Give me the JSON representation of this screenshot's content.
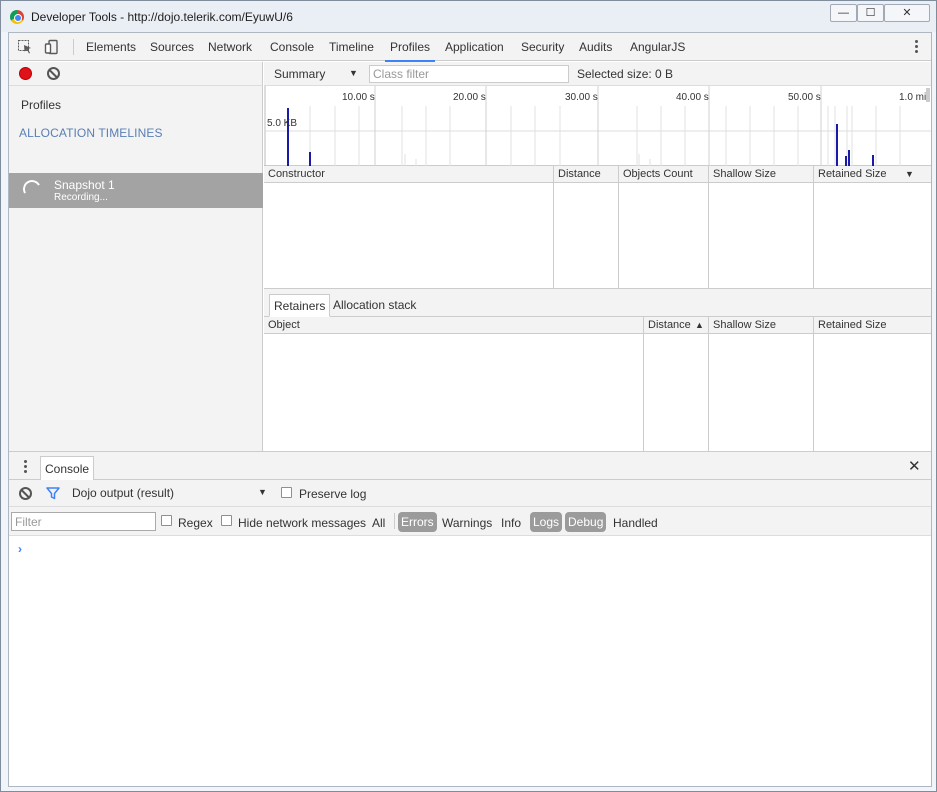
{
  "window": {
    "title": "Developer Tools - http://dojo.telerik.com/EyuwU/6",
    "controls": {
      "minimize": "—",
      "maximize": "☐",
      "close": "✕"
    }
  },
  "devtools": {
    "main_tabs": [
      "Elements",
      "Sources",
      "Network",
      "Console",
      "Timeline",
      "Profiles",
      "Application",
      "Security",
      "Audits",
      "AngularJS"
    ],
    "active_tab": "Profiles"
  },
  "profiles": {
    "section_label": "Profiles",
    "group_heading": "ALLOCATION TIMELINES",
    "snapshot": {
      "title": "Snapshot 1",
      "status": "Recording..."
    }
  },
  "summary_toolbar": {
    "view_select": "Summary",
    "class_filter_placeholder": "Class filter",
    "selected_size": "Selected size: 0 B"
  },
  "timeline": {
    "ticks": [
      "10.00 s",
      "20.00 s",
      "30.00 s",
      "40.00 s",
      "50.00 s",
      "1.0 mi"
    ],
    "y_label": "5.0 KB"
  },
  "constructor_grid": {
    "columns": [
      "Constructor",
      "Distance",
      "Objects Count",
      "Shallow Size",
      "Retained Size"
    ],
    "sort_indicator": "▼"
  },
  "retainers": {
    "tabs": [
      "Retainers",
      "Allocation stack"
    ],
    "columns": [
      "Object",
      "Distance",
      "Shallow Size",
      "Retained Size"
    ],
    "sort_indicator": "▲"
  },
  "console": {
    "tab_label": "Console",
    "close_glyph": "✕",
    "context": "Dojo output (result)",
    "preserve_log": "Preserve log",
    "filter_placeholder": "Filter",
    "regex": "Regex",
    "hide_network": "Hide network messages",
    "levels": [
      "All",
      "Errors",
      "Warnings",
      "Info",
      "Logs",
      "Debug",
      "Handled"
    ],
    "prompt": "›"
  },
  "icons": {
    "inspect": "inspect-element-icon",
    "device": "device-mode-icon",
    "record": "record-icon",
    "clear": "clear-icon",
    "filter": "filter-funnel-icon"
  },
  "colors": {
    "accent": "#3e82f7",
    "record": "#e0111a",
    "selected_item": "#a3a3a3",
    "heading": "#5a7fb3"
  }
}
